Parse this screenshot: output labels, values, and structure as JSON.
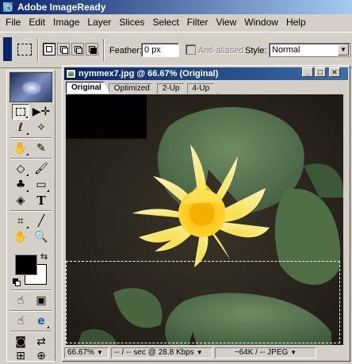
{
  "app": {
    "title": "Adobe ImageReady"
  },
  "menu": [
    "File",
    "Edit",
    "Image",
    "Layer",
    "Slices",
    "Select",
    "Filter",
    "View",
    "Window",
    "Help"
  ],
  "options": {
    "feather_label": "Feather:",
    "feather_value": "0 px",
    "antialias_label": "Anti-aliased",
    "style_label": "Style:",
    "style_value": "Normal"
  },
  "document": {
    "title": "nymmex7.jpg @ 66.67% (Original)",
    "tabs": [
      "Original",
      "Optimized",
      "2-Up",
      "4-Up"
    ],
    "active_tab": "Original",
    "status": {
      "zoom": "66.67%",
      "download": "-- / -- sec @ 28.8 Kbps",
      "size": "~64K / -- JPEG"
    }
  },
  "colors": {
    "foreground": "#000000",
    "background": "#ffffff",
    "titlebar": "#0a246a"
  },
  "tools": [
    "marquee-icon",
    "move-icon",
    "lasso-icon",
    "magic-wand-icon",
    "crop-icon",
    "eyedropper-icon",
    "eraser-icon",
    "brush-icon",
    "stamp-icon",
    "rectangle-icon",
    "paint-bucket-icon",
    "text-icon",
    "slice-icon",
    "pencil-icon",
    "hand-icon",
    "zoom-icon",
    "image-map-icon",
    "slice-select-icon",
    "preview-icon",
    "browser-icon"
  ]
}
